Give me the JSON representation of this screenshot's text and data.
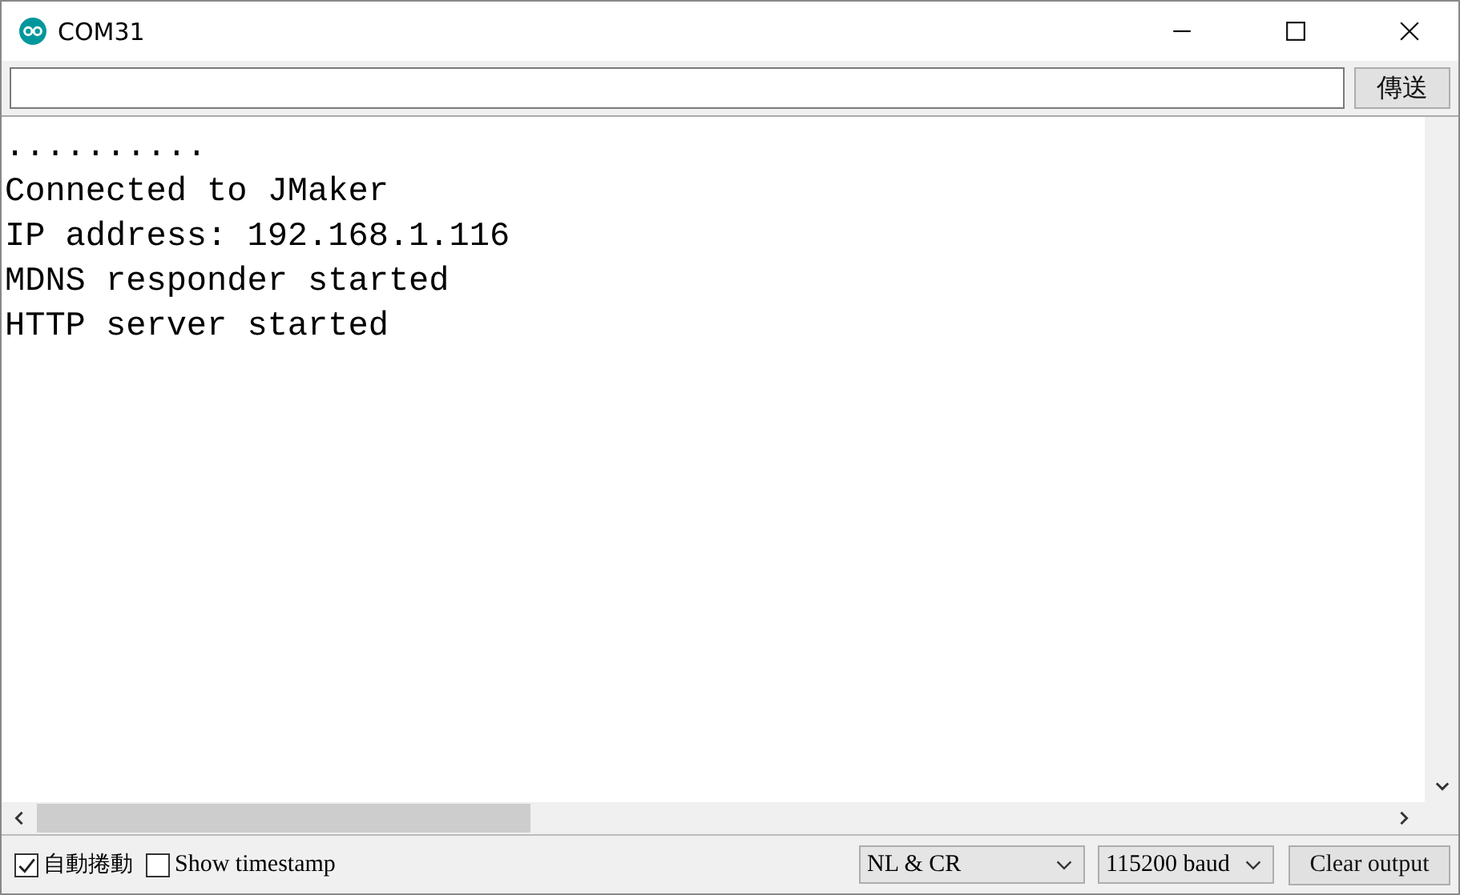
{
  "window": {
    "title": "COM31"
  },
  "send_button": {
    "label": "傳送"
  },
  "output_lines": [
    "..........",
    "Connected to JMaker",
    "IP address: 192.168.1.116",
    "MDNS responder started",
    "HTTP server started"
  ],
  "autoscroll": {
    "label": "自動捲動",
    "checked": true
  },
  "timestamp": {
    "label": "Show timestamp",
    "checked": false
  },
  "line_ending": {
    "value": "NL & CR"
  },
  "baud": {
    "value": "115200 baud"
  },
  "clear_button": {
    "label": "Clear output"
  }
}
